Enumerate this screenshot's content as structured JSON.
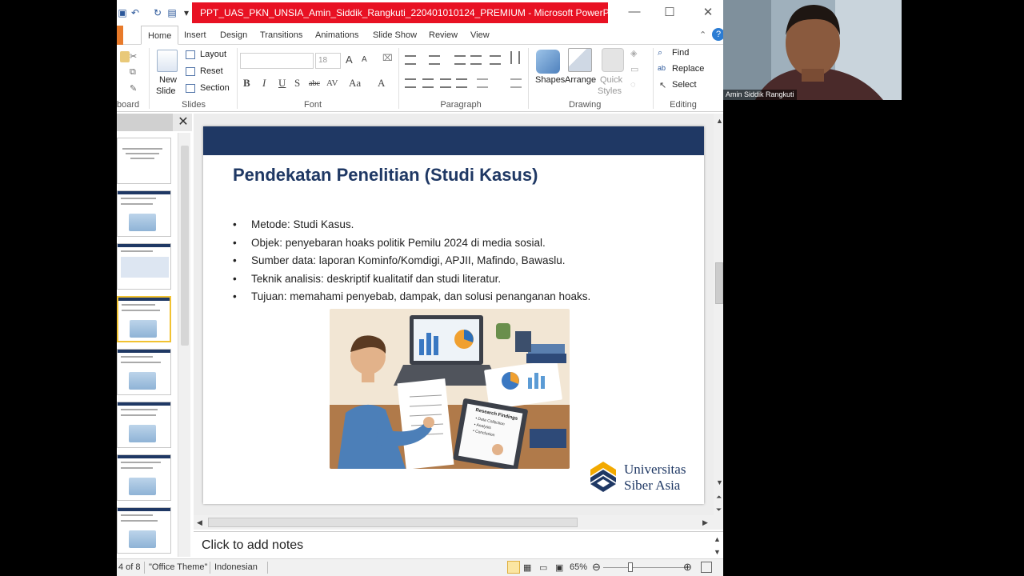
{
  "window": {
    "title": "PPT_UAS_PKN_UNSIA_Amin_Siddik_Rangkuti_220401010124_PREMIUM - Microsoft PowerPoi..."
  },
  "tabs": [
    "Home",
    "Insert",
    "Design",
    "Transitions",
    "Animations",
    "Slide Show",
    "Review",
    "View"
  ],
  "ribbon": {
    "clipboard_label": "board",
    "slides": {
      "new_slide": "New",
      "new_slide2": "Slide",
      "layout": "Layout",
      "reset": "Reset",
      "section": "Section",
      "label": "Slides"
    },
    "font": {
      "size": "18",
      "label": "Font"
    },
    "paragraph": {
      "label": "Paragraph"
    },
    "drawing": {
      "shapes": "Shapes",
      "arrange": "Arrange",
      "quick_styles": "Quick",
      "quick_styles2": "Styles",
      "label": "Drawing"
    },
    "editing": {
      "find": "Find",
      "replace": "Replace",
      "select": "Select",
      "label": "Editing"
    }
  },
  "slide": {
    "title": "Pendekatan Penelitian (Studi Kasus)",
    "bullets": [
      "Metode: Studi Kasus.",
      "Objek: penyebaran hoaks politik Pemilu 2024 di media sosial.",
      "Sumber data: laporan Kominfo/Komdigi, APJII, Mafindo, Bawaslu.",
      "Teknik analisis: deskriptif kualitatif dan studi literatur.",
      "Tujuan: memahami penyebab, dampak, dan solusi penanganan hoaks."
    ],
    "bullet_char": "•",
    "clipboard_text": "Research Findings",
    "clipboard_items": [
      "• Data Collection",
      "• Analysis",
      "• Conclusion"
    ],
    "logo_line1": "Universitas",
    "logo_line2": "Siber Asia",
    "colors": {
      "title": "#1f3864",
      "band": "#1f3864"
    }
  },
  "notes": {
    "placeholder": "Click to add notes"
  },
  "status": {
    "slide_counter": "4 of 8",
    "theme": "\"Office Theme\"",
    "language": "Indonesian",
    "zoom": "65%"
  },
  "webcam": {
    "name": "Amin Siddik Rangkuti"
  },
  "icons": [
    "undo-icon",
    "redo-icon",
    "close-icon",
    "maximize-icon",
    "minimize-icon",
    "find-icon",
    "replace-icon",
    "select-icon"
  ]
}
